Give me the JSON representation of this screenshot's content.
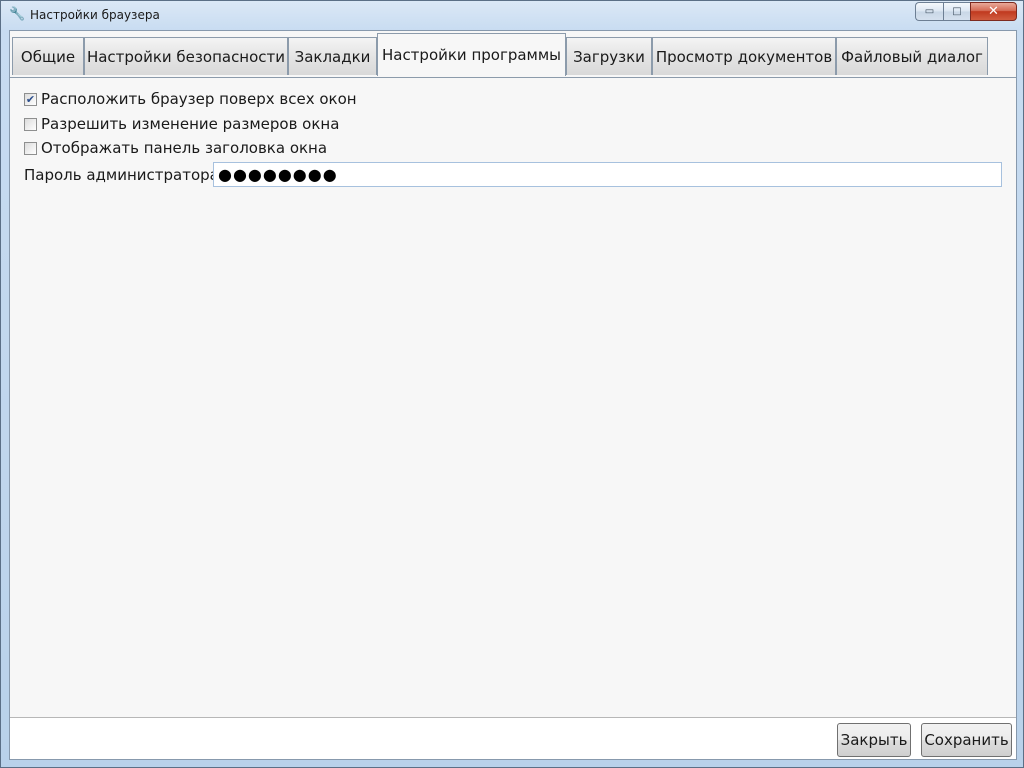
{
  "window": {
    "title": "Настройки браузера",
    "icon": "wrench-icon",
    "controls": {
      "minimize": "▭",
      "maximize": "□",
      "close": "✕"
    }
  },
  "tabs": [
    {
      "label": "Общие",
      "active": false
    },
    {
      "label": "Настройки безопасности",
      "active": false
    },
    {
      "label": "Закладки",
      "active": false
    },
    {
      "label": "Настройки программы",
      "active": true
    },
    {
      "label": "Загрузки",
      "active": false
    },
    {
      "label": "Просмотр документов",
      "active": false
    },
    {
      "label": "Файловый диалог",
      "active": false
    }
  ],
  "settings": {
    "always_on_top": {
      "label": "Расположить браузер поверх всех окон",
      "checked": true
    },
    "allow_resize": {
      "label": "Разрешить изменение размеров окна",
      "checked": false
    },
    "show_titlebar": {
      "label": "Отображать панель заголовка окна",
      "checked": false
    },
    "admin_password": {
      "label": "Пароль администратора",
      "value": "●●●●●●●●"
    }
  },
  "buttons": {
    "close": "Закрыть",
    "save": "Сохранить"
  },
  "colors": {
    "checkmark": "#2b4e8c",
    "close_button": "#c0391f"
  }
}
